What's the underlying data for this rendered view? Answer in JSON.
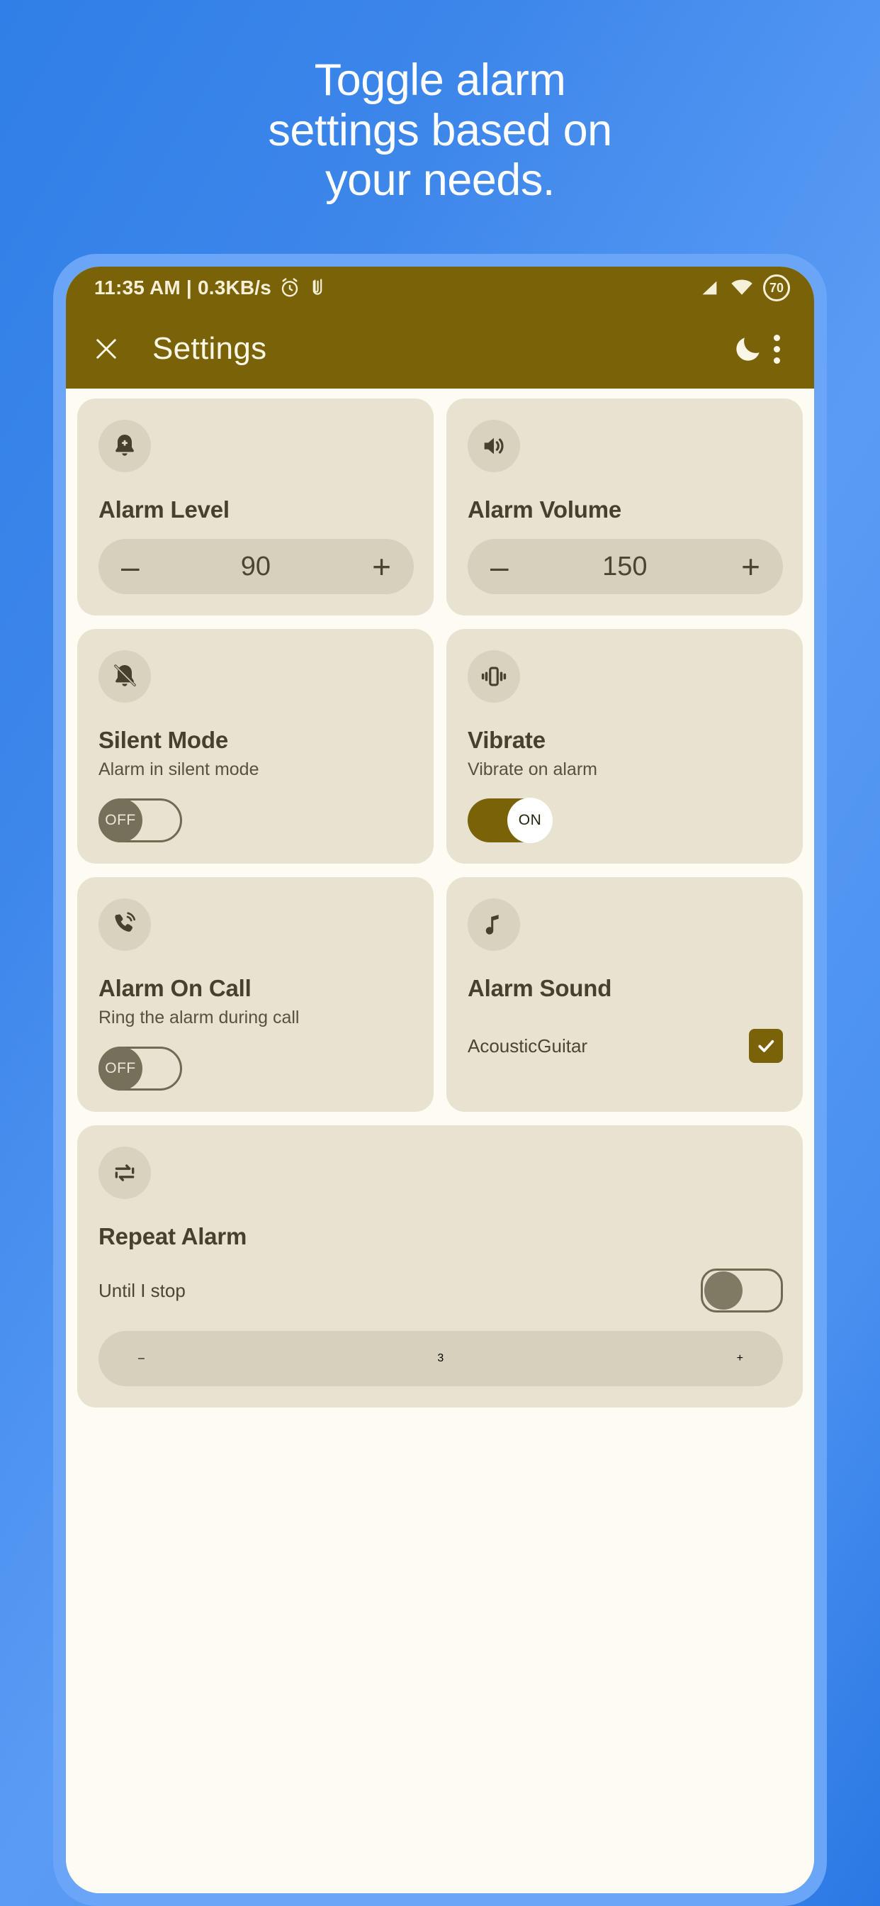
{
  "promo": {
    "headline": "Toggle alarm\nsettings based on\nyour needs."
  },
  "phone": {
    "status_bar": {
      "time_and_net": "11:35 AM | 0.3KB/s",
      "alarm_icon": "alarm-clock-icon",
      "clip_icon": "paperclip-icon",
      "signal_icon": "cell-signal-icon",
      "wifi_icon": "wifi-icon",
      "battery_level": "70"
    },
    "app_bar": {
      "close_label": "close-icon",
      "title": "Settings",
      "night_mode_icon": "moon-icon",
      "overflow_icon": "more-vertical-icon"
    }
  },
  "cards": {
    "alarm_level": {
      "icon": "bell-plus-icon",
      "title": "Alarm Level",
      "minus": "–",
      "value": "90",
      "plus": "+"
    },
    "alarm_volume": {
      "icon": "volume-up-icon",
      "title": "Alarm Volume",
      "minus": "–",
      "value": "150",
      "plus": "+"
    },
    "silent_mode": {
      "icon": "bell-slash-icon",
      "title": "Silent Mode",
      "subtitle": "Alarm in silent mode",
      "toggle_state": "OFF"
    },
    "vibrate": {
      "icon": "vibrate-icon",
      "title": "Vibrate",
      "subtitle": "Vibrate on alarm",
      "toggle_state": "ON"
    },
    "alarm_on_call": {
      "icon": "phone-ring-icon",
      "title": "Alarm On Call",
      "subtitle": "Ring the alarm during call",
      "toggle_state": "OFF"
    },
    "alarm_sound": {
      "icon": "music-note-icon",
      "title": "Alarm Sound",
      "sound_name": "AcousticGuitar",
      "checked": "checked"
    },
    "repeat_alarm": {
      "icon": "repeat-icon",
      "title": "Repeat Alarm",
      "until_label": "Until I stop",
      "toggle_state": "off",
      "minus": "–",
      "count": "3",
      "plus": "+"
    }
  },
  "colors": {
    "brand_olive": "#7a6208",
    "card_bg": "#e8e2d0",
    "screen_bg": "#fdfbf2",
    "frame_blue": "#6aa5f7",
    "page_blue": "#3d86ea"
  }
}
